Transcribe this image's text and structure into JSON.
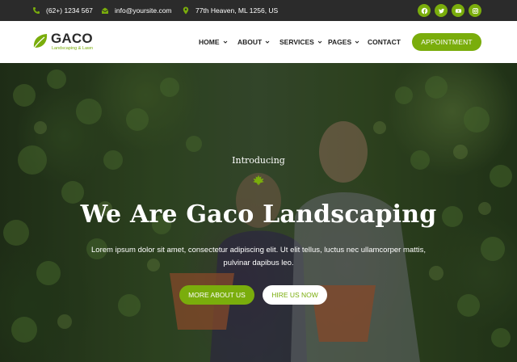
{
  "topbar": {
    "phone": "(62+) 1234 567",
    "email": "info@yoursite.com",
    "address": "77th Heaven, ML 1256, US",
    "socials": [
      "facebook-icon",
      "twitter-icon",
      "youtube-icon",
      "instagram-icon"
    ]
  },
  "header": {
    "logo_name": "GACO",
    "logo_tagline": "Landscaping & Lawn",
    "nav": [
      {
        "label": "HOME",
        "dropdown": true
      },
      {
        "label": "ABOUT",
        "dropdown": true
      },
      {
        "label": "SERVICES",
        "dropdown": true
      },
      {
        "label": "PAGES",
        "dropdown": true
      },
      {
        "label": "CONTACT",
        "dropdown": false
      }
    ],
    "cta_label": "APPOINTMENT"
  },
  "hero": {
    "intro": "Introducing",
    "headline": "We Are Gaco Landscaping",
    "description": "Lorem ipsum dolor sit amet, consectetur adipiscing elit. Ut elit tellus, luctus nec ullamcorper mattis, pulvinar dapibus leo.",
    "primary_button": "MORE ABOUT US",
    "secondary_button": "HIRE US NOW"
  },
  "colors": {
    "accent": "#7aad0c",
    "topbar_bg": "#2b2b2b",
    "header_bg": "#ffffff"
  }
}
